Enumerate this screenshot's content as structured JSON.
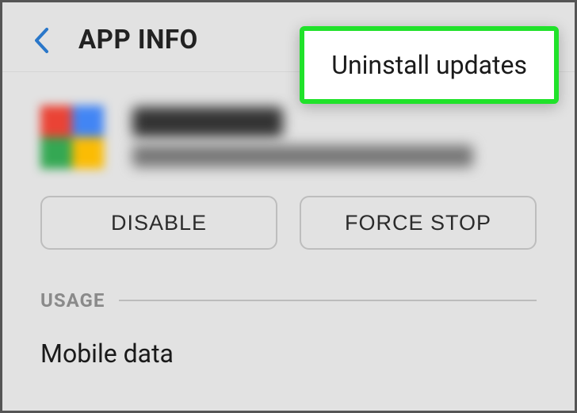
{
  "header": {
    "title": "APP INFO"
  },
  "popup": {
    "label": "Uninstall updates",
    "highlight_color": "#20e22a"
  },
  "app": {
    "name_obscured": true,
    "version_obscured": true
  },
  "actions": {
    "disable": "DISABLE",
    "force_stop": "FORCE STOP"
  },
  "usage": {
    "section_title": "USAGE",
    "items": [
      "Mobile data"
    ]
  }
}
